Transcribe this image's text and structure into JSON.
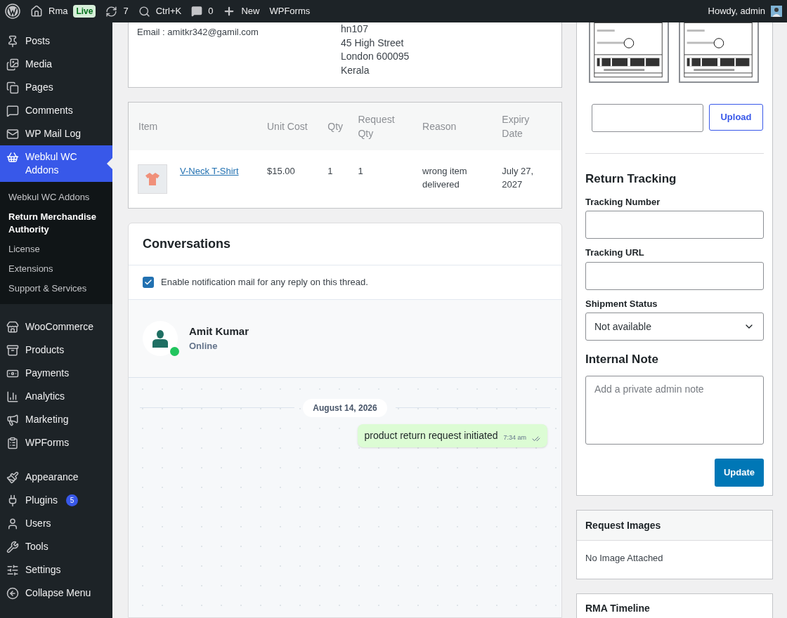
{
  "admin_bar": {
    "site": "Rma",
    "live_badge": "Live",
    "updates": "7",
    "search": "Ctrl+K",
    "comments": "0",
    "new": "New",
    "plugin_link": "WPForms",
    "greeting": "Howdy, admin"
  },
  "sidebar": {
    "groups": [
      [
        {
          "label": "Posts",
          "selected": false
        },
        {
          "label": "Media",
          "selected": false
        },
        {
          "label": "Pages",
          "selected": false
        },
        {
          "label": "Comments",
          "selected": false
        },
        {
          "label": "WP Mail Log",
          "selected": false
        },
        {
          "label": "Webkul WC Addons",
          "selected": true,
          "children": [
            {
              "label": "Webkul WC Addons",
              "selected": false
            },
            {
              "label": "Return Merchandise Authority",
              "selected": true
            },
            {
              "label": "License",
              "selected": false
            },
            {
              "label": "Extensions",
              "selected": false
            },
            {
              "label": "Support & Services",
              "selected": false
            }
          ]
        }
      ],
      [
        {
          "label": "WooCommerce",
          "selected": false
        },
        {
          "label": "Products",
          "selected": false
        },
        {
          "label": "Payments",
          "selected": false
        },
        {
          "label": "Analytics",
          "selected": false
        },
        {
          "label": "Marketing",
          "selected": false
        },
        {
          "label": "WPForms",
          "selected": false
        }
      ],
      [
        {
          "label": "Appearance",
          "selected": false
        },
        {
          "label": "Plugins",
          "selected": false,
          "badge": "5"
        },
        {
          "label": "Users",
          "selected": false
        },
        {
          "label": "Tools",
          "selected": false
        },
        {
          "label": "Settings",
          "selected": false
        },
        {
          "label": "Collapse Menu",
          "selected": false
        }
      ]
    ]
  },
  "customer": {
    "email": "Email : amitkr342@gamil.com",
    "address": [
      "hn107",
      "45 High Street",
      "London 600095",
      "Kerala"
    ]
  },
  "items_table": {
    "columns": [
      "Item",
      "",
      "Unit Cost",
      "Qty",
      "Request Qty",
      "Reason",
      "Expiry Date"
    ],
    "rows": [
      {
        "product": "V-Neck T-Shirt",
        "unit_cost": "$15.00",
        "qty": "1",
        "request_qty": "1",
        "reason": "wrong item delivered",
        "expiry": "July 27, 2027"
      }
    ]
  },
  "conversations": {
    "title": "Conversations",
    "notify": {
      "label": "Enable notification mail for any reply on this thread.",
      "checked": true
    },
    "contact": {
      "name": "Amit Kumar",
      "status": "Online",
      "color": "#22c55e"
    },
    "date": "August 14, 2026",
    "messages": [
      {
        "text": "product return request initiated",
        "time": "7:34 am",
        "read": true
      }
    ]
  },
  "shipping": {
    "upload_button": "Upload",
    "title": "Return Tracking",
    "fields": [
      {
        "label": "Tracking Number",
        "kind": "text"
      },
      {
        "label": "Tracking URL",
        "kind": "text"
      },
      {
        "label": "Shipment Status",
        "kind": "select",
        "value": "Not available"
      }
    ],
    "note_title": "Internal Note",
    "note_placeholder": "Add a private admin note",
    "update_button": "Update"
  },
  "request_images": {
    "title": "Request Images",
    "text": "No Image Attached"
  },
  "timeline": {
    "title": "RMA Timeline"
  }
}
